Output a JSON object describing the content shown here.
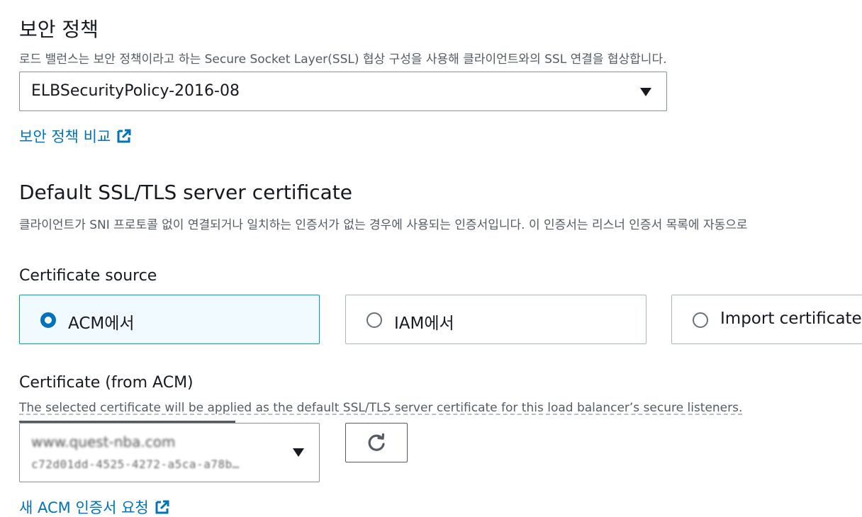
{
  "security_policy": {
    "heading": "보안 정책",
    "description": "로드 밸런스는 보안 정책이라고 하는 Secure Socket Layer(SSL) 협상 구성을 사용해 클라이언트와의 SSL 연결을 협상합니다.",
    "selected_policy": "ELBSecurityPolicy-2016-08",
    "compare_link": "보안 정책 비교"
  },
  "default_cert": {
    "heading": "Default SSL/TLS server certificate",
    "description": "클라이언트가 SNI 프로토콜 없이 연결되거나 일치하는 인증서가 없는 경우에 사용되는 인증서입니다. 이 인증서는 리스너 인증서 목록에 자동으로"
  },
  "certificate_source": {
    "label": "Certificate source",
    "options": [
      {
        "label": "ACM에서",
        "selected": true
      },
      {
        "label": "IAM에서",
        "selected": false
      },
      {
        "label": "Import certificate",
        "selected": false
      }
    ]
  },
  "certificate_acm": {
    "label": "Certificate (from ACM)",
    "description": "The selected certificate will be applied as the default SSL/TLS server certificate for this load balancer’s secure listeners.",
    "selected_domain": "www.quest-nba.com",
    "selected_id": "c72d01dd-4525-4272-a5ca-a78b…",
    "new_cert_link": "새 ACM 인증서 요청"
  },
  "icons": {
    "external_link": "external-link-icon",
    "refresh": "refresh-icon",
    "dropdown": "caret-down-icon"
  },
  "colors": {
    "link": "#0073bb",
    "selected_border": "#00a1c9",
    "selected_bg": "#f1faff",
    "radio_on": "#0073bb"
  }
}
